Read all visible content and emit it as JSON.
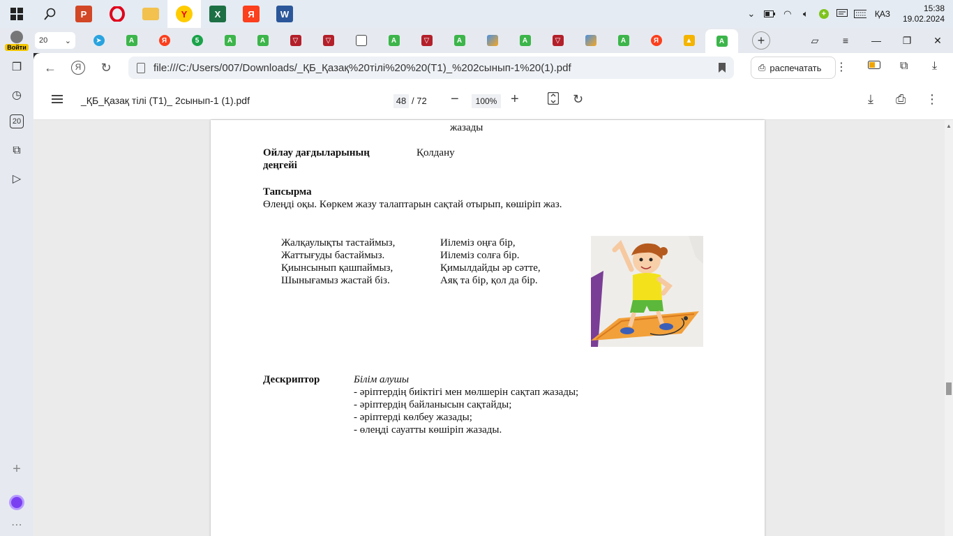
{
  "taskbar": {
    "apps": [
      "start",
      "search",
      "powerpoint",
      "opera",
      "file-explorer",
      "yandex-browser",
      "excel",
      "yandex",
      "word"
    ],
    "language": "ҚАЗ",
    "time": "15:38",
    "date": "19.02.2024"
  },
  "browser": {
    "profile_label": "Войти",
    "tab_count": "20",
    "url": "file:///C:/Users/007/Downloads/_ҚБ_Қазақ%20тілі%20%20(Т1)_%202сынып-1%20(1).pdf",
    "print_label": "распечатать",
    "sidebar_count": "20"
  },
  "pdf": {
    "filename": "_ҚБ_Қазақ тілі (Т1)_ 2сынып-1 (1).pdf",
    "current_page": "48",
    "total_pages": "/ 72",
    "zoom": "100%"
  },
  "document": {
    "top_fragment": "жазады",
    "skill_label_1": "Ойлау дағдыларының",
    "skill_label_2": "деңгейі",
    "skill_value": "Қолдану",
    "task_heading": "Тапсырма",
    "task_text": "Өлеңді оқы. Көркем жазу талаптарын  сақтай отырып, көшіріп жаз.",
    "poem_left": [
      "Жалқаулықты тастаймыз,",
      "Жаттығуды бастаймыз.",
      "Қиынсынып қашпаймыз,",
      "Шынығамыз жастай біз."
    ],
    "poem_right": [
      "Иілеміз оңға бір,",
      "Иілеміз солға бір.",
      "Қимылдайды әр сәтте,",
      "Аяқ та бір, қол да бір."
    ],
    "descriptor_label": "Дескриптор",
    "descriptor_subject": "Білім алушы",
    "descriptor_items": [
      "- әріптердің биіктігі мен мөлшерін сақтап жазады;",
      "- әріптердің  байланысын сақтайды;",
      "- әріптерді  көлбеу жазады;",
      "- өлеңді сауатты көшіріп жазады."
    ]
  }
}
